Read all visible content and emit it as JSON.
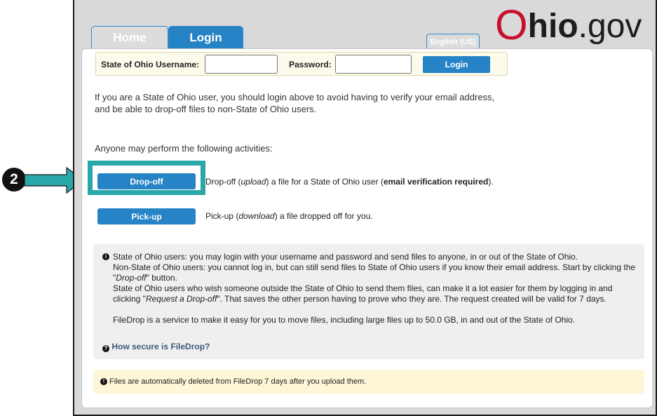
{
  "annotation": {
    "step_number": "2",
    "highlight_color": "#2aa7a9"
  },
  "header": {
    "tabs": [
      {
        "label": "Home"
      },
      {
        "label": "Login"
      }
    ],
    "language_label": "English (US)",
    "logo": {
      "o": "O",
      "hio": "hio",
      "gov": ".gov"
    }
  },
  "login_bar": {
    "username_label": "State of Ohio Username:",
    "password_label": "Password:",
    "login_button": "Login"
  },
  "intro": {
    "line1": "If you are a State of Ohio user, you should login above to avoid having to verify your email address,",
    "line2": "and be able to drop-off files to non-State of Ohio users."
  },
  "activities_heading": "Anyone may perform the following activities:",
  "actions": {
    "dropoff": {
      "button": "Drop-off",
      "desc_pre": "Drop-off (",
      "desc_em": "upload",
      "desc_mid": ") a file for a State of Ohio user (",
      "desc_strong": "email verification required",
      "desc_post": ")."
    },
    "pickup": {
      "button": "Pick-up",
      "desc_pre": "Pick-up (",
      "desc_em": "download",
      "desc_post": ") a file dropped off for you."
    }
  },
  "info_box": {
    "line1": "State of Ohio users: you may login with your username and password and send files to anyone, in or out of the State of Ohio.",
    "line2": "Non-State of Ohio users: you cannot log in, but can still send files to State of Ohio users if you know their email address. Start by clicking the",
    "line3_q1": "\"",
    "line3_em": "Drop-off",
    "line3_rest": "\" button.",
    "line4": "State of Ohio users who wish someone outside the State of Ohio to send them files, can make it a lot easier for them by logging in and",
    "line5_pre": "clicking \"",
    "line5_em": "Request a Drop-off",
    "line5_rest": "\". That saves the other person having to prove who they are. The request created will be valid for 7 days.",
    "line6": "FileDrop is a service to make it easy for you to move files, including large files up to 50.0 GB, in and out of the State of Ohio.",
    "secure_link": "How secure is FileDrop?"
  },
  "notice": "Files are automatically deleted from FileDrop 7 days after you upload them.",
  "colors": {
    "accent_blue": "#2683c6",
    "ohio_red": "#c8102e",
    "annotation_teal": "#2aa7a9"
  }
}
